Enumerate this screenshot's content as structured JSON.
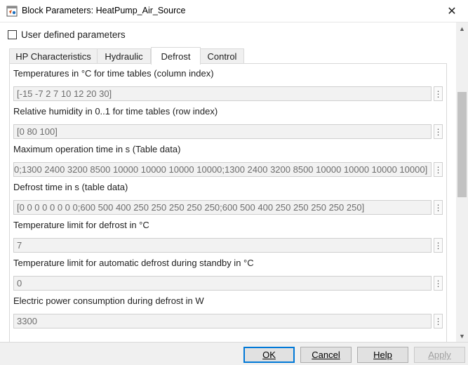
{
  "window": {
    "title": "Block Parameters: HeatPump_Air_Source",
    "close_glyph": "✕"
  },
  "user_defined": {
    "label": "User defined parameters",
    "checked": false
  },
  "tabs": [
    {
      "label": "HP Characteristics",
      "active": false
    },
    {
      "label": "Hydraulic",
      "active": false
    },
    {
      "label": "Defrost",
      "active": true
    },
    {
      "label": "Control",
      "active": false
    }
  ],
  "params": [
    {
      "label": "Temperatures in °C for time tables (column index)",
      "value": "[-15 -7 2 7 10 12 20 30]"
    },
    {
      "label": "Relative humidity in 0..1 for  time tables (row index)",
      "value": "[0 80 100]"
    },
    {
      "label": "Maximum operation time in s (Table data)",
      "value": "0;1300 2400 3200 8500 10000 10000 10000 10000;1300 2400 3200 8500 10000 10000 10000 10000]"
    },
    {
      "label": "Defrost time in s (table data)",
      "value": "[0 0 0 0 0 0 0 0;600 500 400 250 250 250 250 250;600 500 400 250 250 250 250 250]"
    },
    {
      "label": "Temperature limit for defrost in °C",
      "value": "7"
    },
    {
      "label": "Temperature limit for automatic defrost during standby in °C",
      "value": "0"
    },
    {
      "label": "Electric power consumption during defrost in W",
      "value": "3300"
    }
  ],
  "param_menu_glyph": "⋮",
  "scroll": {
    "up": "▲",
    "down": "▼"
  },
  "buttons": {
    "ok": "OK",
    "cancel": "Cancel",
    "help": "Help",
    "apply": "Apply"
  },
  "colors": {
    "accent": "#0078d7",
    "field_bg": "#f2f2f2",
    "field_text": "#6d6d6d"
  }
}
